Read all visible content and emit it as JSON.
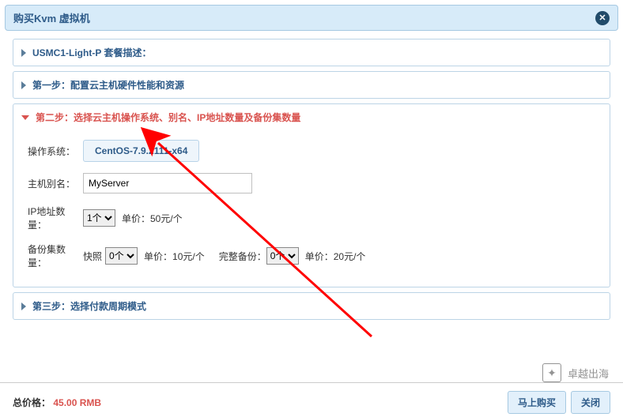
{
  "titlebar": {
    "title": "购买Kvm 虚拟机"
  },
  "accordion": {
    "step1_package": "USMC1-Light-P 套餐描述：",
    "step1_config": "第一步：配置云主机硬件性能和资源",
    "step2": "第二步：选择云主机操作系统、别名、IP地址数量及备份集数量",
    "step3": "第三步：选择付款周期模式"
  },
  "form": {
    "os_label": "操作系统：",
    "os_value": "CentOS-7.9.2111-x64",
    "alias_label": "主机别名：",
    "alias_value": "MyServer",
    "ip_count_label": "IP地址数量：",
    "ip_count_value": "1个",
    "ip_unit_label": "单价：50元/个",
    "backup_label": "备份集数量：",
    "snapshot_label": "快照",
    "snapshot_value": "0个",
    "snapshot_unit": "单价：10元/个",
    "full_backup_label": "完整备份：",
    "full_backup_value": "0个",
    "full_backup_unit": "单价：20元/个"
  },
  "footer": {
    "total_label": "总价格：",
    "total_price": "45.00 RMB",
    "buy_now": "马上购买",
    "close": "关闭"
  },
  "watermark": {
    "text": "卓越出海"
  }
}
